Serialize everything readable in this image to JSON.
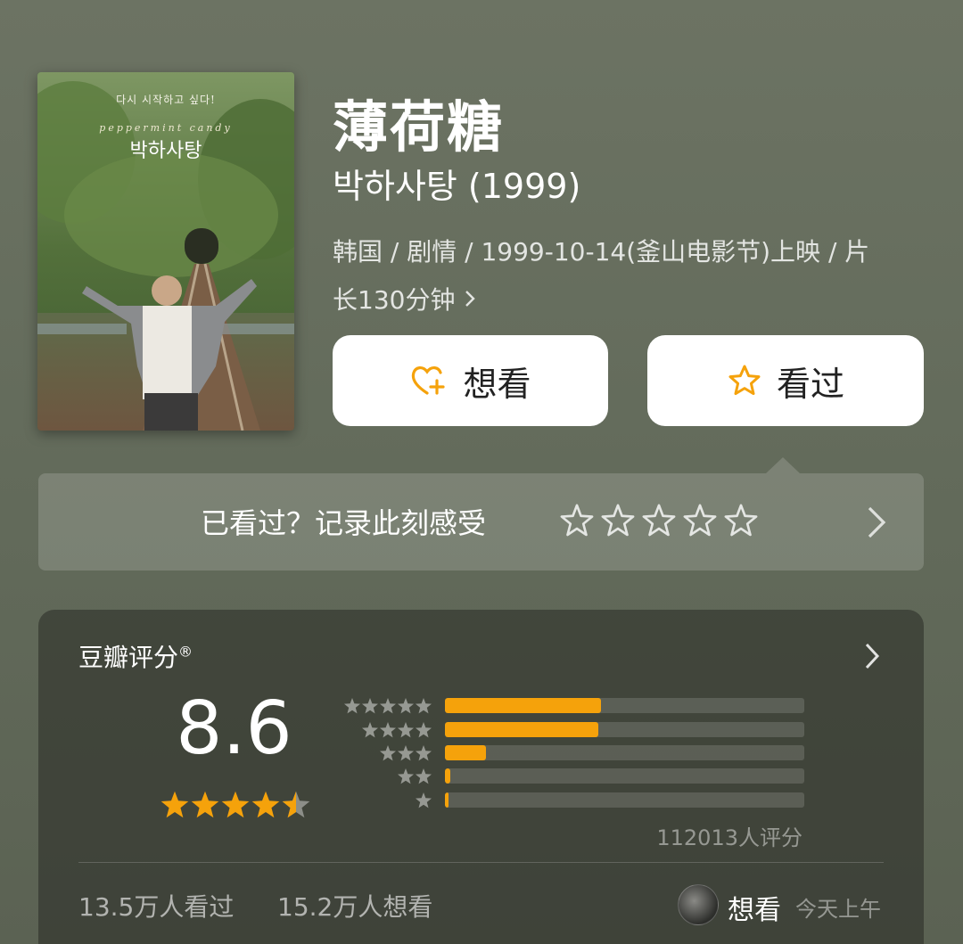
{
  "poster": {
    "tagline": "다시 시작하고 싶다!",
    "english_title": "peppermint candy",
    "korean_title": "박하사탕"
  },
  "movie": {
    "title": "薄荷糖",
    "original_title": "박하사탕 (1999)",
    "meta_line1": "韩国 / 剧情 / 1999-10-14(釜山电影节)上映 / 片",
    "meta_line2": "长130分钟"
  },
  "actions": {
    "want_label": "想看",
    "seen_label": "看过"
  },
  "rate_prompt": {
    "text": "已看过？记录此刻感受",
    "star_count": 5
  },
  "douban_score": {
    "label": "豆瓣评分",
    "registered_mark": "®",
    "score": "8.6",
    "stars_rating": 4.5,
    "distribution": [
      {
        "stars": 5,
        "percent": 43.5
      },
      {
        "stars": 4,
        "percent": 42.8
      },
      {
        "stars": 3,
        "percent": 11.3
      },
      {
        "stars": 2,
        "percent": 1.5
      },
      {
        "stars": 1,
        "percent": 0.9
      }
    ],
    "rating_count": "112013人评分",
    "seen_count": "13.5万人看过",
    "want_count": "15.2万人想看",
    "friend_action": "想看",
    "friend_time": "今天上午"
  },
  "colors": {
    "accent": "#f5a20b",
    "background": "#666d5e"
  }
}
